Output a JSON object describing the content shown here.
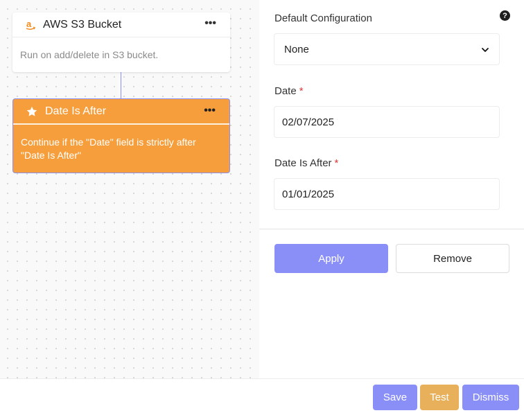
{
  "canvas": {
    "trigger_node": {
      "icon": "amazon-icon",
      "title": "AWS S3 Bucket",
      "description": "Run on add/delete in S3 bucket.",
      "menu_label": "•••"
    },
    "action_node": {
      "icon": "star-icon",
      "title": "Date Is After",
      "description": "Continue if the \"Date\" field is strictly after \"Date Is After\"",
      "menu_label": "•••",
      "color": "#f59e3b"
    }
  },
  "panel": {
    "default_config": {
      "label": "Default Configuration",
      "value": "None",
      "help_icon": "help-icon",
      "help_text": "?"
    },
    "date": {
      "label": "Date",
      "required_mark": "*",
      "value": "02/07/2025"
    },
    "date_is_after": {
      "label": "Date Is After",
      "required_mark": "*",
      "value": "01/01/2025"
    },
    "apply_label": "Apply",
    "remove_label": "Remove"
  },
  "footer": {
    "save_label": "Save",
    "test_label": "Test",
    "dismiss_label": "Dismiss"
  },
  "colors": {
    "accent": "#8a8ff7",
    "node_orange": "#f59e3b",
    "test_button": "#e8b05a",
    "required": "#e03a3a"
  }
}
